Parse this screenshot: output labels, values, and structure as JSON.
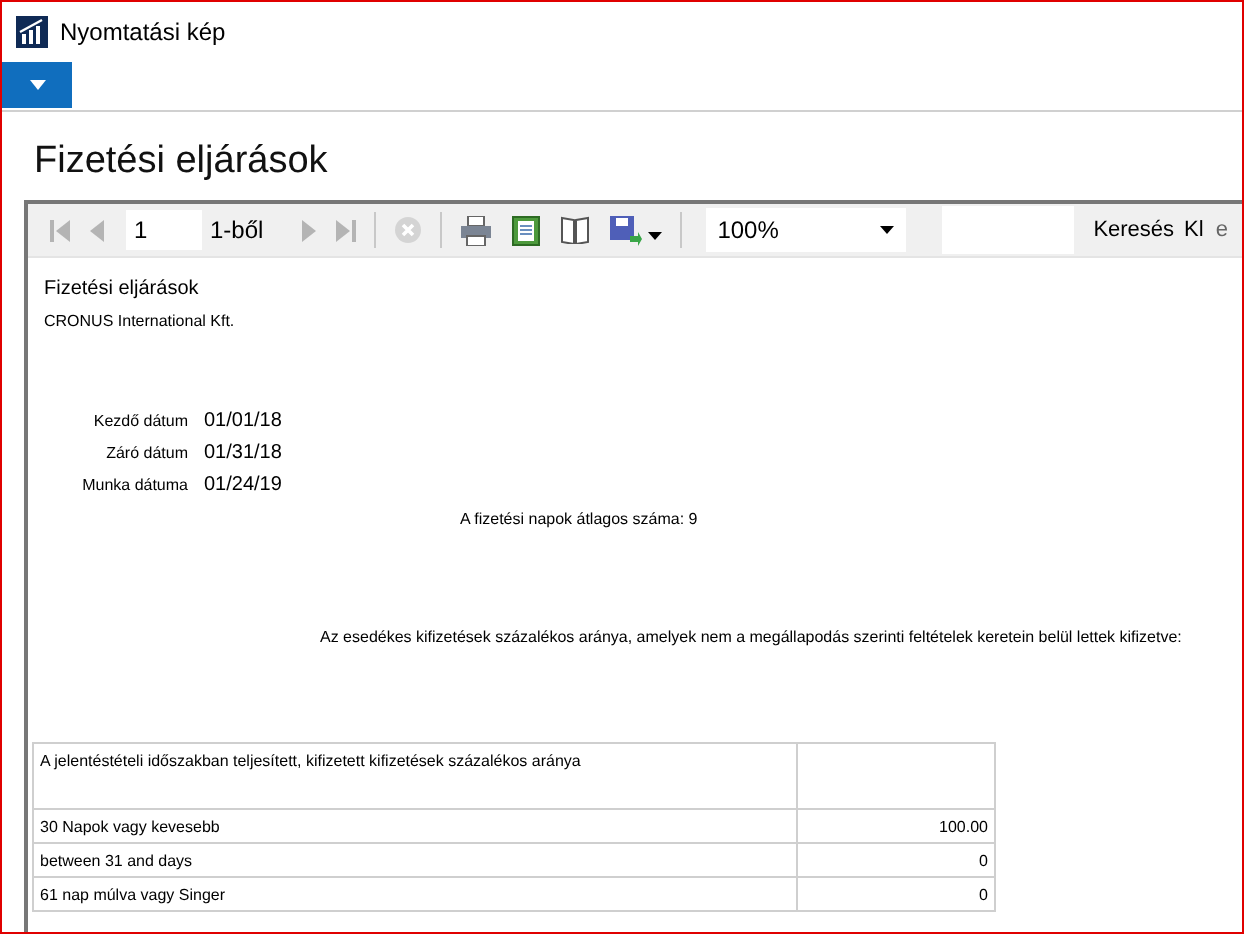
{
  "window": {
    "title": "Nyomtatási kép"
  },
  "page_title": "Fizetési eljárások",
  "toolbar": {
    "page": "1",
    "page_of": "1-ből",
    "zoom": "100%",
    "find_label": "Keresés",
    "find_next": "Kl",
    "cut_label": "e"
  },
  "report": {
    "title": "Fizetési eljárások",
    "company": "CRONUS International Kft.",
    "dates": [
      {
        "label": "Kezdő dátum",
        "value": "01/01/18"
      },
      {
        "label": "Záró dátum",
        "value": "01/31/18"
      },
      {
        "label": "Munka dátuma",
        "value": "01/24/19"
      }
    ],
    "average": "A fizetési napok átlagos száma: 9",
    "sentence": "Az esedékes kifizetések százalékos aránya, amelyek nem a megállapodás szerinti feltételek keretein belül lettek kifizetve:",
    "table": {
      "header": "A jelentéstételi időszakban teljesített, kifizetett kifizetések százalékos aránya",
      "rows": [
        {
          "label": "30 Napok vagy kevesebb",
          "value": "100.00"
        },
        {
          "label": "between 31 and days",
          "value": "0"
        },
        {
          "label": "61 nap múlva vagy Singer",
          "value": "0"
        }
      ]
    }
  }
}
